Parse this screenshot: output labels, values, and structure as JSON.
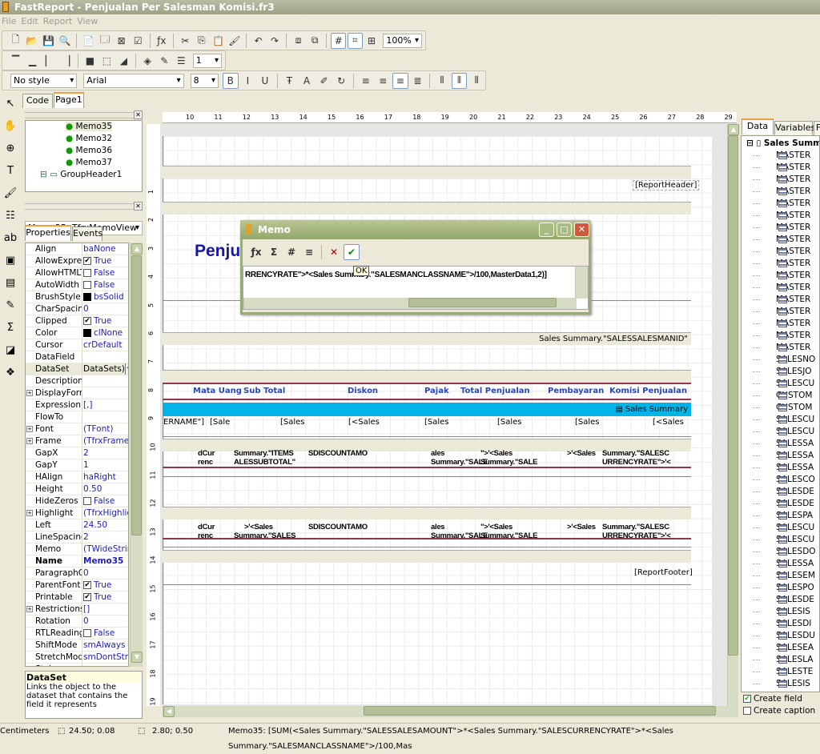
{
  "app": {
    "title": "FastReport - Penjualan Per Salesman Komisi.fr3",
    "menu": [
      "File",
      "Edit",
      "Report",
      "View"
    ]
  },
  "toolbar": {
    "row1": [
      "new-icon",
      "open-icon",
      "save-icon",
      "preview-icon",
      "|",
      "new-page-icon",
      "new-dialog-icon",
      "delete-page-icon",
      "page-settings-icon",
      "|",
      "fx-icon",
      "|",
      "cut-icon",
      "copy-icon",
      "paste-icon",
      "format-painter-icon",
      "|",
      "undo-icon",
      "redo-icon",
      "|",
      "group-icon",
      "ungroup-icon",
      "|",
      "grid-icon",
      "snap-grid-icon",
      "align-grid-icon"
    ],
    "zoom": "100%",
    "row2": [
      "frame-top-icon",
      "frame-bottom-icon",
      "frame-left-icon",
      "frame-right-icon",
      "|",
      "frame-all-icon",
      "frame-none-icon",
      "shadow-icon",
      "|",
      "fill-color-icon",
      "frame-color-icon",
      "frame-style-icon"
    ],
    "frame_width": "1",
    "style": "No style",
    "font": "Arial",
    "font_size": "8",
    "row3": [
      "bold-icon",
      "italic-icon",
      "underline-icon",
      "|",
      "font-icon",
      "font-color-icon",
      "highlight-icon",
      "rotation-icon",
      "|",
      "align-left-icon",
      "align-center-icon",
      "align-right-icon",
      "justify-icon",
      "|",
      "valign-top-icon",
      "valign-center-icon",
      "valign-bottom-icon"
    ],
    "active": [
      "grid-icon",
      "snap-grid-icon",
      "bold-icon",
      "align-right-icon",
      "valign-center-icon"
    ]
  },
  "left_tools": [
    "select-icon",
    "hand-icon",
    "zoom-icon",
    "text-tool-icon",
    "format-painter-icon",
    "band-icon",
    "memo-text-icon",
    "picture-icon",
    "subreport-icon",
    "highlight-tool-icon",
    "sum-icon",
    "shape-icon",
    "more-objects-icon"
  ],
  "tabs": [
    "Code",
    "Page1"
  ],
  "tree": {
    "items": [
      "Memo35",
      "Memo32",
      "Memo36",
      "Memo37",
      "GroupHeader1"
    ]
  },
  "object_selector": "Memo35: TfrxMemoView",
  "inspector_tabs": [
    "Properties",
    "Events"
  ],
  "properties": [
    {
      "n": "Align",
      "v": "baNone"
    },
    {
      "n": "AllowExpressions",
      "v": "True",
      "c": true
    },
    {
      "n": "AllowHTMLTags",
      "v": "False",
      "c": false
    },
    {
      "n": "AutoWidth",
      "v": "False",
      "c": false
    },
    {
      "n": "BrushStyle",
      "v": "bsSolid",
      "s": "#000000"
    },
    {
      "n": "CharSpacing",
      "v": "0"
    },
    {
      "n": "Clipped",
      "v": "True",
      "c": true
    },
    {
      "n": "Color",
      "v": "clNone",
      "s": "#000000"
    },
    {
      "n": "Cursor",
      "v": "crDefault"
    },
    {
      "n": "DataField",
      "v": ""
    },
    {
      "n": "DataSet",
      "v": "DataSets)",
      "sel": true
    },
    {
      "n": "Description",
      "v": ""
    },
    {
      "n": "DisplayFormat",
      "v": "",
      "p": true
    },
    {
      "n": "ExpressionDelimiters",
      "v": "[,]"
    },
    {
      "n": "FlowTo",
      "v": ""
    },
    {
      "n": "Font",
      "v": "(TFont)",
      "p": true
    },
    {
      "n": "Frame",
      "v": "(TfrxFrame)",
      "p": true
    },
    {
      "n": "GapX",
      "v": "2"
    },
    {
      "n": "GapY",
      "v": "1"
    },
    {
      "n": "HAlign",
      "v": "haRight"
    },
    {
      "n": "Height",
      "v": "0.50"
    },
    {
      "n": "HideZeros",
      "v": "False",
      "c": false
    },
    {
      "n": "Highlight",
      "v": "(TfrxHighlight)",
      "p": true
    },
    {
      "n": "Left",
      "v": "24.50"
    },
    {
      "n": "LineSpacing",
      "v": "2"
    },
    {
      "n": "Memo",
      "v": "(TWideStrings)"
    },
    {
      "n": "Name",
      "v": "Memo35",
      "b": true
    },
    {
      "n": "ParagraphGap",
      "v": "0"
    },
    {
      "n": "ParentFont",
      "v": "True",
      "c": true
    },
    {
      "n": "Printable",
      "v": "True",
      "c": true
    },
    {
      "n": "Restrictions",
      "v": "[]",
      "p": true
    },
    {
      "n": "Rotation",
      "v": "0"
    },
    {
      "n": "RTLReading",
      "v": "False",
      "c": false
    },
    {
      "n": "ShiftMode",
      "v": "smAlways"
    },
    {
      "n": "StretchMode",
      "v": "smDontStretch"
    },
    {
      "n": "Style",
      "v": ""
    }
  ],
  "description": {
    "title": "DataSet",
    "text": "Links the object to the dataset that contains the field it represents"
  },
  "report": {
    "report_header": "[ReportHeader]",
    "title_text": "Penju",
    "group_header": "Sales Summary.\"SALESSALESMANID\"",
    "columns": [
      "Mata Uang",
      "Sub Total",
      "Diskon",
      "Pajak",
      "Total Penjualan",
      "Pembayaran",
      "Komisi Penjualan"
    ],
    "master_band": "Sales Summary",
    "master_cells": [
      "ERNAME\"]",
      "[Sale",
      "[Sales",
      "[<Sales",
      "[Sales",
      "[Sales",
      "[Sales",
      "[<Sales"
    ],
    "footer1_line1": [
      "dCur",
      "Summary.\"ITEMS",
      "SDISCOUNTAMO",
      "ales",
      "\">'<Sales",
      ">'<Sales",
      "Summary.\"SALESC"
    ],
    "footer1_line2": [
      "renc",
      "ALESSUBTOTAL\"",
      "Summary.\"SALE",
      "Summary.\"SALE",
      "URRENCYRATE\">'<"
    ],
    "footer2_line1": [
      "dCur",
      ">'<Sales",
      "SDISCOUNTAMO",
      "ales",
      "\">'<Sales",
      ">'<Sales",
      "Summary.\"SALESC"
    ],
    "footer2_line2": [
      "renc",
      "Summary.\"SALES",
      "Summary.\"SALE",
      "Summary.\"SALE",
      "URRENCYRATE\">'<"
    ],
    "report_footer": "[ReportFooter]",
    "ruler_h": [
      "10",
      "11",
      "12",
      "13",
      "14",
      "15",
      "16",
      "17",
      "18",
      "19",
      "20",
      "21",
      "22",
      "23",
      "24",
      "25",
      "26",
      "27",
      "28",
      "29"
    ],
    "ruler_v": [
      "1",
      "2",
      "3",
      "4",
      "5",
      "6",
      "7",
      "8",
      "9",
      "10",
      "11",
      "12",
      "13",
      "14",
      "15",
      "16",
      "17",
      "18",
      "19"
    ]
  },
  "memo_dialog": {
    "title": "Memo",
    "tools": [
      "fx-icon",
      "sum-icon",
      "format-icon",
      "word-wrap-icon",
      "cancel-icon",
      "ok-icon"
    ],
    "text": "RRENCYRATE\">*<Sales Summary.\"SALESMANCLASSNAME\">/100,MasterData1,2)]",
    "tooltip": "OK"
  },
  "data_panel": {
    "tabs": [
      "Data",
      "Variables",
      "F"
    ],
    "root": "Sales Summary",
    "fields": [
      "MASTER",
      "MASTER",
      "MASTER",
      "MASTER",
      "MASTER",
      "MASTER",
      "MASTER",
      "MASTER",
      "MASTER",
      "MASTER",
      "MASTER",
      "MASTER",
      "MASTER",
      "MASTER",
      "MASTER",
      "MASTER",
      "MASTER",
      "SALESNO",
      "SALESJO",
      "SALESCU",
      "CUSTOM",
      "CUSTOM",
      "SALESCU",
      "SALESCU",
      "SALESSA",
      "SALESSA",
      "SALESSA",
      "SALESCO",
      "SALESDE",
      "SALESDE",
      "SALESPA",
      "SALESCU",
      "SALESCU",
      "SALESDO",
      "SALESSA",
      "SALESEM",
      "SALESPO",
      "SALESDE",
      "SALESIS",
      "SALESDI",
      "SALESDU",
      "SALESEA",
      "SALESLA",
      "SALESTE",
      "SALESIS"
    ],
    "create_field": {
      "label": "Create field",
      "checked": true
    },
    "create_caption": {
      "label": "Create caption",
      "checked": false
    }
  },
  "status": {
    "units": "Centimeters",
    "position": "24.50; 0.08",
    "size": "2.80; 0.50",
    "text": "Memo35: [SUM(<Sales Summary.\"SALESSALESAMOUNT\">*<Sales Summary.\"SALESCURRENCYRATE\">*<Sales Summary.\"SALESMANCLASSNAME\">/100,Mas"
  },
  "colors": {
    "master_band": "#00b4e8",
    "column_header": "#2848b4",
    "band_header": "#ebe9d8"
  }
}
